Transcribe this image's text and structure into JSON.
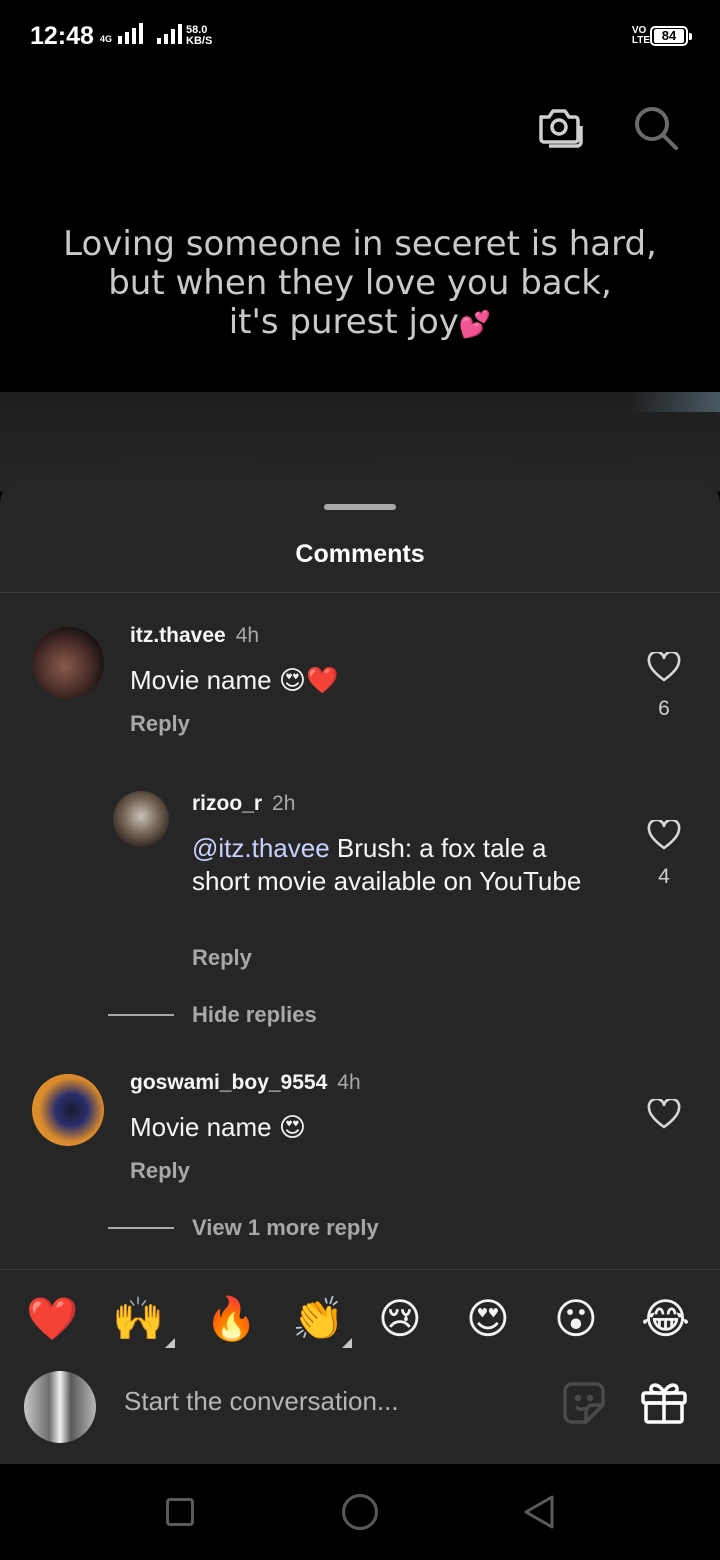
{
  "status_bar": {
    "time": "12:48",
    "net_tag": "4G",
    "speed_value": "58.0",
    "speed_unit": "KB/S",
    "volte_line1": "VO",
    "volte_line2": "LTE",
    "battery": "84"
  },
  "post": {
    "line1": "Loving someone in seceret is hard,",
    "line2": "but when they love you back,",
    "line3": "it's purest joy",
    "emoji": "💕"
  },
  "sheet": {
    "title": "Comments"
  },
  "comments": [
    {
      "username": "itz.thavee",
      "time": "4h",
      "text": "Movie name 😍❤️",
      "reply_label": "Reply",
      "likes": "6"
    },
    {
      "username": "rizoo_r",
      "time": "2h",
      "mention": "@itz.thavee",
      "text": " Brush: a fox tale a short movie available on YouTube",
      "reply_label": "Reply",
      "likes": "4"
    },
    {
      "username": "goswami_boy_9554",
      "time": "4h",
      "text": "Movie name 😍",
      "reply_label": "Reply"
    }
  ],
  "thread_controls": {
    "hide_replies": "Hide replies",
    "view_more": "View 1 more reply"
  },
  "quick_reactions": [
    "❤️",
    "🙌",
    "🔥",
    "👏",
    "😢",
    "😍",
    "😮",
    "😂"
  ],
  "compose": {
    "placeholder": "Start the conversation..."
  },
  "icons": {
    "top": [
      "camera-icon",
      "search-icon"
    ],
    "compose": [
      "sticker-icon",
      "gift-icon"
    ],
    "nav": [
      "recents-icon",
      "home-icon",
      "back-icon"
    ]
  },
  "colors": {
    "sheet_bg": "#262626",
    "secondary_text": "#a8a8a8",
    "mention": "#c7d2ff"
  }
}
